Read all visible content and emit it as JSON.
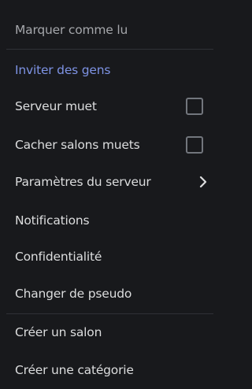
{
  "menu": {
    "mark_read": "Marquer comme lu",
    "invite": "Inviter des gens",
    "mute_server": "Serveur muet",
    "hide_muted_channels": "Cacher salons muets",
    "server_settings": "Paramètres du serveur",
    "notifications": "Notifications",
    "privacy": "Confidentialité",
    "change_nickname": "Changer de pseudo",
    "create_channel": "Créer un salon",
    "create_category": "Créer une catégorie",
    "mute_server_checked": false,
    "hide_muted_channels_checked": false
  },
  "colors": {
    "background": "#18191c",
    "text": "#dcddde",
    "muted_text": "#a5a7ab",
    "accent": "#7e93e4",
    "divider": "#2f3136",
    "checkbox_border": "#72767d"
  }
}
